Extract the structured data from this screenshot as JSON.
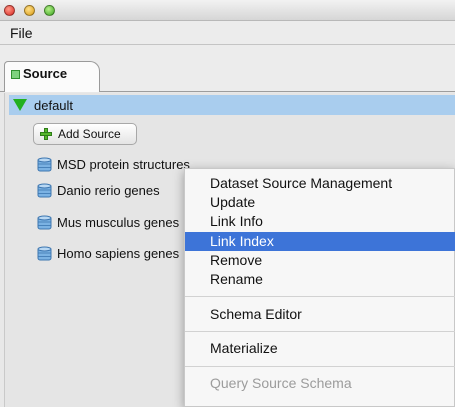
{
  "menubar": {
    "file_label": "File"
  },
  "tabs": [
    {
      "label": "Source"
    }
  ],
  "tree": {
    "root_label": "default",
    "add_button_label": "Add Source",
    "sources": [
      {
        "label": "MSD protein structures"
      },
      {
        "label": "Danio rerio genes"
      },
      {
        "label": "Mus musculus genes"
      },
      {
        "label": "Homo sapiens genes"
      }
    ]
  },
  "context_menu": {
    "items": [
      {
        "label": "Dataset Source Management",
        "state": "normal"
      },
      {
        "label": "Update",
        "state": "normal"
      },
      {
        "label": "Link Info",
        "state": "normal"
      },
      {
        "label": "Link Index",
        "state": "highlighted"
      },
      {
        "label": "Remove",
        "state": "normal"
      },
      {
        "label": "Rename",
        "state": "normal"
      },
      {
        "label": "Schema Editor",
        "state": "normal"
      },
      {
        "label": "Materialize",
        "state": "normal"
      },
      {
        "label": "Query Source Schema",
        "state": "disabled"
      }
    ]
  },
  "colors": {
    "selection": "#3d74d8",
    "tree_selection": "#a9cdee",
    "root_arrow": "#21b01f",
    "db_icon": "#6fa8dc"
  },
  "icons": [
    "close-button",
    "minimize-button",
    "zoom-button",
    "tab-status-icon",
    "expand-arrow-icon",
    "plus-icon",
    "database-icon"
  ]
}
